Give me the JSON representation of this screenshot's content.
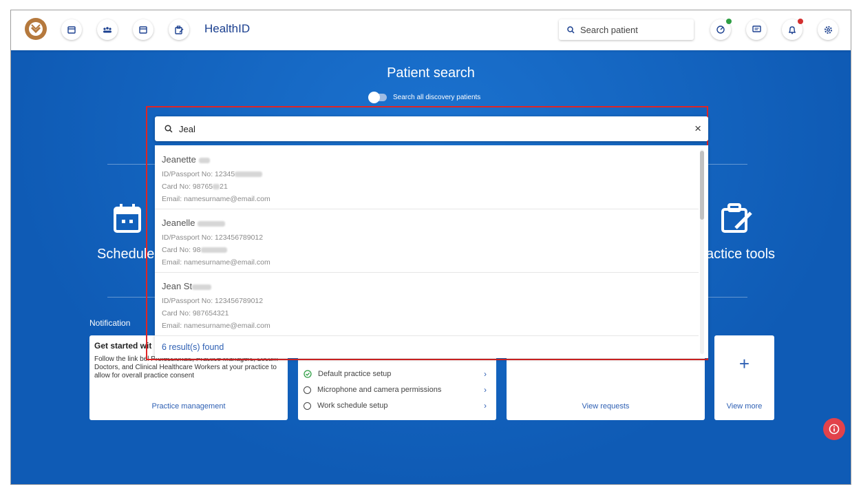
{
  "app": {
    "title": "HealthID",
    "top_search_placeholder": "Search patient",
    "accent": "#1467c4",
    "brand": "#b5793d",
    "nav_icons": [
      "calendar-icon",
      "patients-icon",
      "card-icon",
      "clipboard-icon"
    ],
    "right_icons": [
      "stethoscope-icon",
      "chat-icon",
      "bell-icon",
      "settings-icon"
    ]
  },
  "page": {
    "title": "Patient search",
    "toggle_label": "Search all discovery patients",
    "tiles": [
      {
        "label": "Schedule",
        "visible_text": "Schedule"
      },
      {
        "label": "Practice tools",
        "visible_text": "actice tools"
      }
    ],
    "notification_heading": "Notification"
  },
  "search": {
    "query": "Jeal",
    "results": [
      {
        "first_name": "Jeanette",
        "id_label": "ID/Passport No: 12345",
        "card_label": "Card No: 98765",
        "card_suffix": "21",
        "email": "Email: namesurname@email.com"
      },
      {
        "first_name": "Jeanelle",
        "id_label": "ID/Passport No: 123456789012",
        "card_label": "Card No: 98",
        "card_suffix": "",
        "email": "Email: namesurname@email.com"
      },
      {
        "first_name": "Jean St",
        "id_label": "ID/Passport No: 123456789012",
        "card_label": "Card No: 987654321",
        "card_suffix": "",
        "email": "Email: namesurname@email.com"
      }
    ],
    "count_text": "6 result(s) found"
  },
  "cards": {
    "getting_started": {
      "title": "Get started wit",
      "body": "Follow the link bel Professionals, Practice Managers, Locum Doctors, and Clinical Healthcare Workers at your practice to allow for overall practice consent",
      "link": "Practice management"
    },
    "setup": {
      "items": [
        "Default practice setup",
        "Microphone and camera permissions",
        "Work schedule setup"
      ]
    },
    "requests": {
      "link": "View requests"
    },
    "more": {
      "link": "View more"
    }
  }
}
